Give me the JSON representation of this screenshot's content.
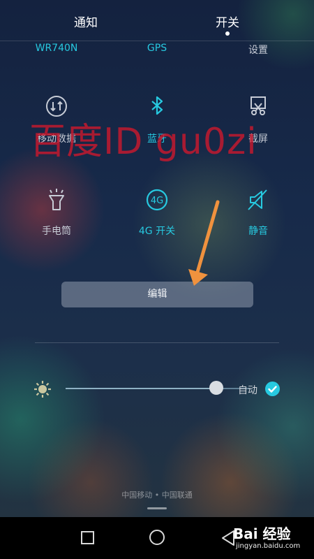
{
  "tabs": [
    {
      "label": "通知"
    },
    {
      "label": "开关"
    }
  ],
  "top_row": [
    "WR740N",
    "GPS",
    "设置"
  ],
  "toggles": [
    {
      "label": "移动数据",
      "icon": "mobile-data-icon",
      "state": "off"
    },
    {
      "label": "蓝牙",
      "icon": "bluetooth-icon",
      "state": "on"
    },
    {
      "label": "截屏",
      "icon": "screenshot-icon",
      "state": "off"
    },
    {
      "label": "手电筒",
      "icon": "flashlight-icon",
      "state": "off"
    },
    {
      "label": "4G 开关",
      "icon": "4g-icon",
      "state": "on",
      "icon_text": "4G"
    },
    {
      "label": "静音",
      "icon": "mute-icon",
      "state": "on"
    }
  ],
  "edit_button": {
    "label": "编辑"
  },
  "brightness": {
    "level": 0.82,
    "auto_label": "自动",
    "auto": true
  },
  "carrier": "中国移动 • 中国联通",
  "watermark": "百度ID gu0zi",
  "baidu": {
    "logo": "Bai 经验",
    "url": "jingyan.baidu.com"
  },
  "colors": {
    "accent": "#27c9e0",
    "watermark": "#c8192d",
    "arrow": "#f0923e"
  }
}
